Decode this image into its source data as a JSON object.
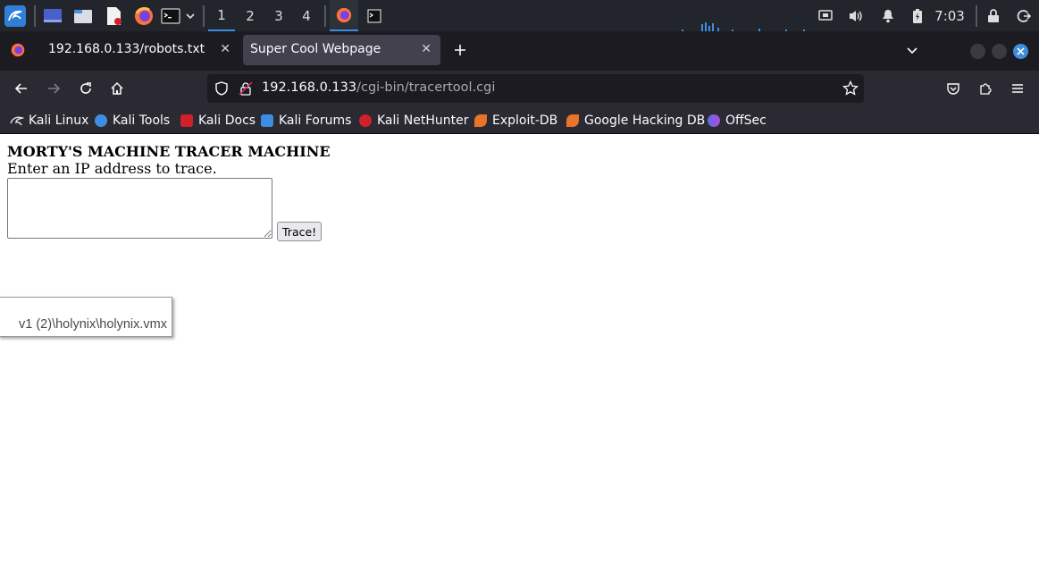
{
  "taskbar": {
    "workspaces": [
      "1",
      "2",
      "3",
      "4"
    ],
    "active_workspace": "1",
    "clock": "7:03",
    "icons": [
      "kali-menu-icon",
      "show-desktop-icon",
      "file-manager-icon",
      "text-editor-icon",
      "firefox-icon",
      "terminal-icon",
      "chevron-down-icon",
      "firefox-window-icon",
      "terminal-window-icon",
      "network-monitor-icon",
      "volume-icon",
      "notification-bell-icon",
      "battery-icon",
      "lock-icon",
      "logout-icon"
    ]
  },
  "tabs": [
    {
      "title": "192.168.0.133/robots.txt",
      "active": false
    },
    {
      "title": "Super Cool Webpage",
      "active": true
    }
  ],
  "navbar": {
    "url_host": "192.168.0.133",
    "url_path": "/cgi-bin/tracertool.cgi"
  },
  "bookmarks": [
    {
      "label": "Kali Linux",
      "color": "#ffffff"
    },
    {
      "label": "Kali Tools",
      "color": "#3d8ee0"
    },
    {
      "label": "Kali Docs",
      "color": "#d0202a"
    },
    {
      "label": "Kali Forums",
      "color": "#3d8ee0"
    },
    {
      "label": "Kali NetHunter",
      "color": "#d0202a"
    },
    {
      "label": "Exploit-DB",
      "color": "#e8742a"
    },
    {
      "label": "Google Hacking DB",
      "color": "#e8742a"
    },
    {
      "label": "OffSec",
      "color": "#5b6ee1"
    }
  ],
  "page": {
    "heading": "MORTY'S MACHINE TRACER MACHINE",
    "prompt": "Enter an IP address to trace.",
    "ip_value": "",
    "button_label": "Trace!"
  },
  "tooltip": {
    "text": "v1 (2)\\holynix\\holynix.vmx"
  },
  "colors": {
    "taskbar_bg": "#22252b",
    "tabbar_bg": "#1c1b22",
    "toolbar_bg": "#2b2a33",
    "active_tab_bg": "#42414d",
    "accent": "#3d8ee0"
  }
}
